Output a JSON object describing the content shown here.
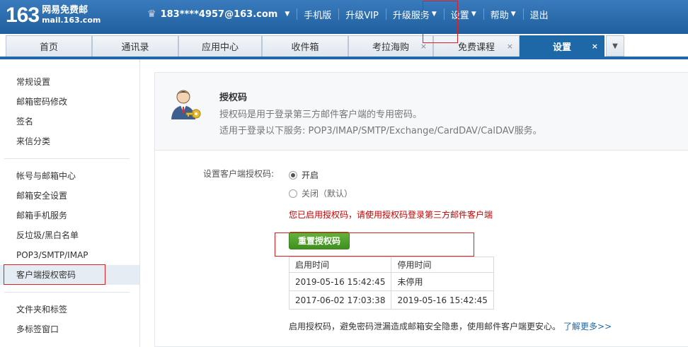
{
  "logo": {
    "number": "163",
    "name": "网易免费邮",
    "domain": "mail.163.com"
  },
  "topnav": {
    "user": "183****4957@163.com",
    "mobile": "手机版",
    "vip": "升级VIP",
    "service": "升级服务",
    "settings": "设置",
    "help": "帮助",
    "logout": "退出"
  },
  "tabs": [
    {
      "label": "首页"
    },
    {
      "label": "通讯录"
    },
    {
      "label": "应用中心"
    },
    {
      "label": "收件箱"
    },
    {
      "label": "考拉海购",
      "close": "×"
    },
    {
      "label": "免费课程",
      "close": "×"
    },
    {
      "label": "设置",
      "close": "×"
    }
  ],
  "sidebar": {
    "group1": [
      "常规设置",
      "邮箱密码修改",
      "签名",
      "来信分类"
    ],
    "group2": [
      "帐号与邮箱中心",
      "邮箱安全设置",
      "邮箱手机服务",
      "反垃圾/黑白名单",
      "POP3/SMTP/IMAP",
      "客户端授权密码"
    ],
    "group3": [
      "文件夹和标签",
      "多标签窗口"
    ]
  },
  "head": {
    "title": "授权码",
    "desc1": "授权码是用于登录第三方邮件客户端的专用密码。",
    "desc2": "适用于登录以下服务: POP3/IMAP/SMTP/Exchange/CardDAV/CalDAV服务。"
  },
  "setting": {
    "label": "设置客户端授权码:",
    "on": "开启",
    "off": "关闭（默认）",
    "notice": "您已启用授权码，请使用授权码登录第三方邮件客户端",
    "reset": "重置授权码"
  },
  "table": {
    "headers": [
      "启用时间",
      "停用时间"
    ],
    "rows": [
      [
        "2019-05-16 15:42:45",
        "未停用"
      ],
      [
        "2017-06-02 17:03:38",
        "2019-05-16 15:42:45"
      ]
    ]
  },
  "footer": {
    "text": "启用授权码，避免密码泄漏造成邮箱安全隐患，使用邮件客户端更安心。",
    "link": "了解更多>>"
  },
  "colors": {
    "header_blue": "#1f68a8",
    "button_green": "#4aa02a",
    "notice_red": "#cc0000",
    "highlight_box": "#e02020"
  }
}
